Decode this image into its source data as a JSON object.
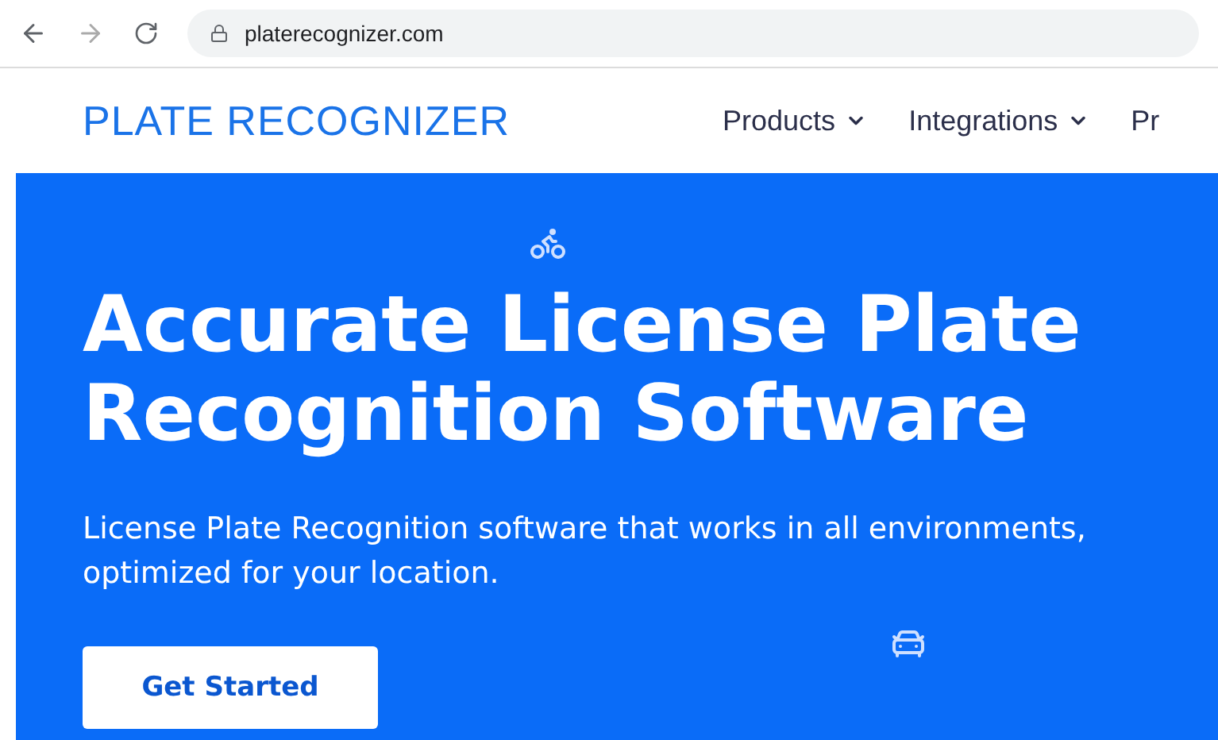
{
  "browser": {
    "url": "platerecognizer.com"
  },
  "header": {
    "logo": "PLATE RECOGNIZER",
    "nav": [
      {
        "label": "Products",
        "dropdown": true
      },
      {
        "label": "Integrations",
        "dropdown": true
      },
      {
        "label": "Pr",
        "dropdown": false
      }
    ]
  },
  "hero": {
    "title": "Accurate License Plate Recognition Software",
    "subtitle": "License Plate Recognition software that works in all environments, optimized for your location.",
    "button": "Get Started"
  }
}
